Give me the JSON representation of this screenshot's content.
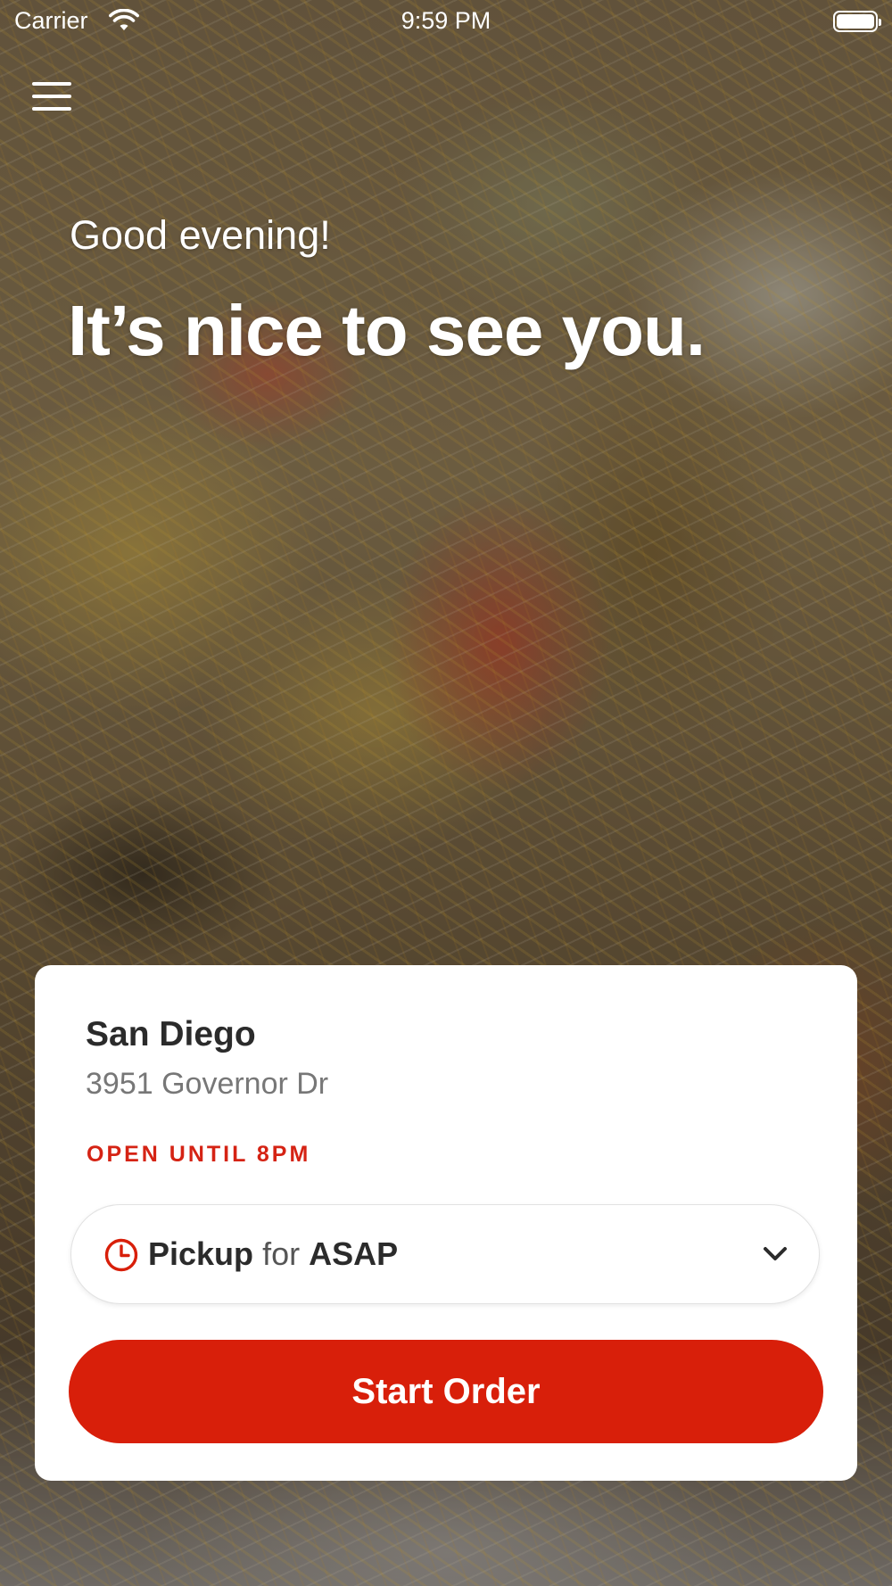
{
  "status_bar": {
    "carrier": "Carrier",
    "time": "9:59 PM"
  },
  "hero": {
    "greeting": "Good evening!",
    "headline": "It’s nice to see you."
  },
  "location": {
    "name": "San Diego",
    "address": "3951 Governor Dr",
    "hours": "OPEN UNTIL 8PM"
  },
  "order_mode": {
    "mode": "Pickup",
    "connector": "for",
    "timing": "ASAP"
  },
  "actions": {
    "start_order": "Start Order"
  },
  "colors": {
    "accent": "#d81f0a",
    "hours_text": "#d52314"
  },
  "icons": {
    "menu": "hamburger-menu-icon",
    "wifi": "wifi-icon",
    "battery": "battery-icon",
    "clock": "clock-icon",
    "chevron": "chevron-down-icon"
  }
}
